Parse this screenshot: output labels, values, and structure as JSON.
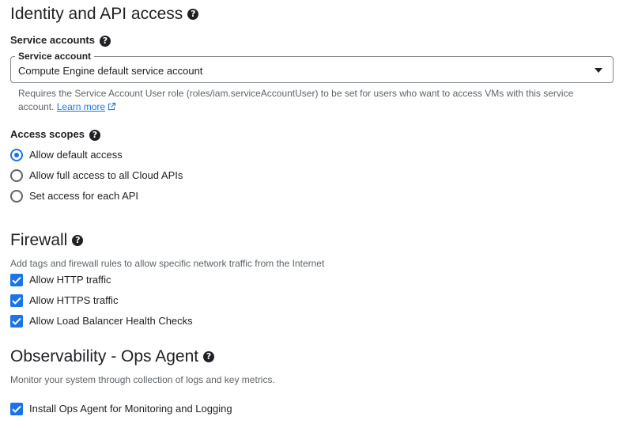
{
  "identity": {
    "title": "Identity and API access",
    "service_accounts_heading": "Service accounts",
    "service_account_field_label": "Service account",
    "service_account_value": "Compute Engine default service account",
    "hint_line1": "Requires the Service Account User role (roles/iam.serviceAccountUser) to be set for users who want to access VMs with this service",
    "hint_line2_prefix": "account.",
    "learn_more": "Learn more",
    "access_scopes_heading": "Access scopes",
    "scopes": [
      {
        "label": "Allow default access",
        "selected": true
      },
      {
        "label": "Allow full access to all Cloud APIs",
        "selected": false
      },
      {
        "label": "Set access for each API",
        "selected": false
      }
    ]
  },
  "firewall": {
    "title": "Firewall",
    "description": "Add tags and firewall rules to allow specific network traffic from the Internet",
    "options": [
      {
        "label": "Allow HTTP traffic",
        "checked": true
      },
      {
        "label": "Allow HTTPS traffic",
        "checked": true
      },
      {
        "label": "Allow Load Balancer Health Checks",
        "checked": true
      }
    ]
  },
  "observability": {
    "title": "Observability - Ops Agent",
    "description": "Monitor your system through collection of logs and key metrics.",
    "option": {
      "label": "Install Ops Agent for Monitoring and Logging",
      "checked": true
    }
  },
  "icons": {
    "help": "help-circle-icon",
    "dropdown": "dropdown-caret-icon",
    "external": "open-in-new-icon",
    "check": "checkmark-icon"
  },
  "colors": {
    "accent": "#1a73e8",
    "text": "#202124",
    "muted": "#5f6368",
    "border": "#80868b"
  }
}
